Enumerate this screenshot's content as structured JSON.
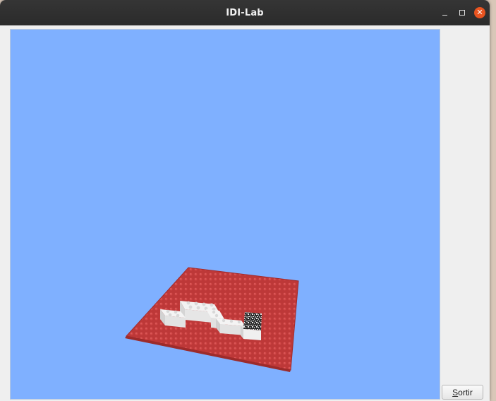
{
  "window": {
    "title": "IDI-Lab"
  },
  "controls": {
    "minimize": "–",
    "maximize": "□",
    "close": "✕"
  },
  "buttons": {
    "sortir": {
      "mnemonic": "S",
      "rest": "ortir"
    }
  },
  "scene": {
    "background_color": "#7fb0ff",
    "baseplate_color": "#b83434",
    "brick_color": "#ffffff",
    "textured_brick_color": "#2a2a2a"
  }
}
